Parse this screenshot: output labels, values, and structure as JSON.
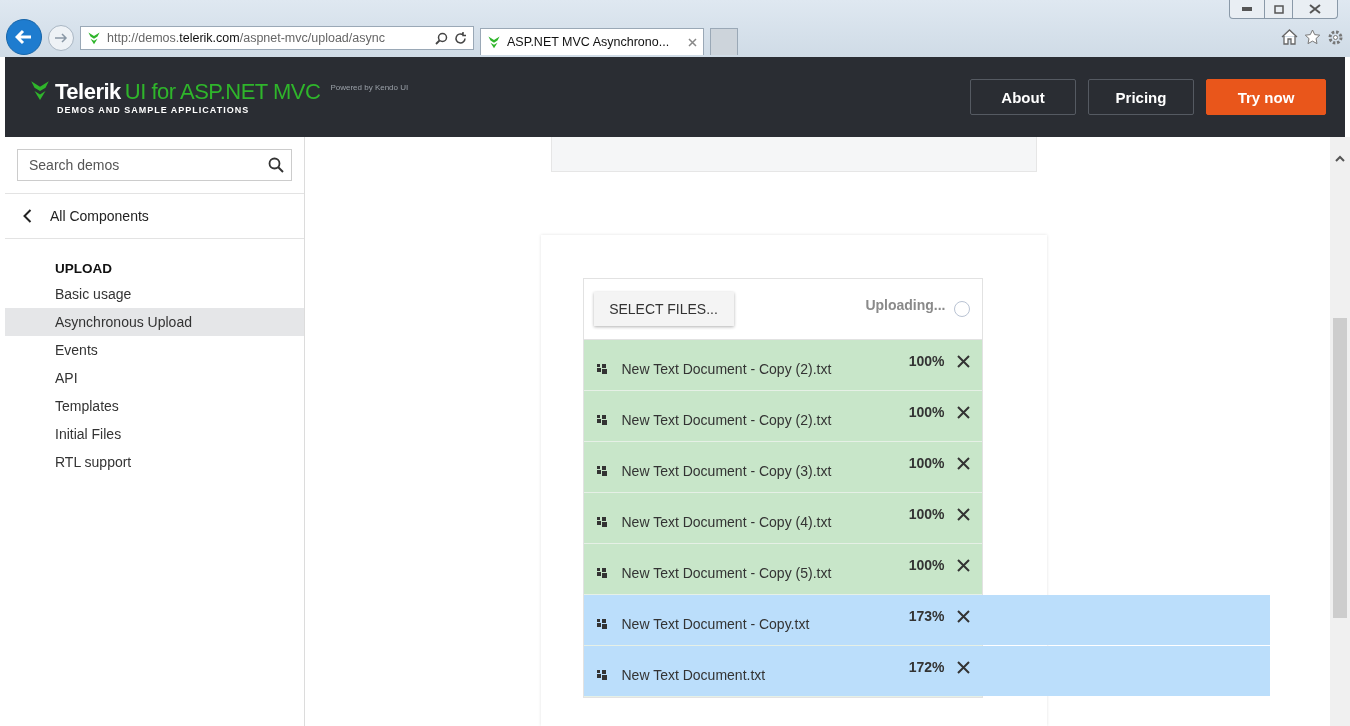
{
  "browser": {
    "address": {
      "prefix": "http://demos.",
      "domain": "telerik.com",
      "path": "/aspnet-mvc/upload/async"
    },
    "tabs": [
      {
        "title": "ASP.NET MVC Asynchrono...",
        "selected": true
      }
    ]
  },
  "header": {
    "brand": "Telerik",
    "product": "UI for ASP.NET MVC",
    "powered": "Powered by Kendo UI",
    "tagline": "DEMOS AND SAMPLE APPLICATIONS",
    "nav": [
      {
        "label": "About",
        "kind": "outline"
      },
      {
        "label": "Pricing",
        "kind": "outline"
      },
      {
        "label": "Try now",
        "kind": "primary"
      }
    ]
  },
  "sidebar": {
    "search": {
      "placeholder": "Search demos"
    },
    "back": "All Components",
    "section": "UPLOAD",
    "items": [
      {
        "label": "Basic usage",
        "selected": false
      },
      {
        "label": "Asynchronous Upload",
        "selected": true
      },
      {
        "label": "Events",
        "selected": false
      },
      {
        "label": "API",
        "selected": false
      },
      {
        "label": "Templates",
        "selected": false
      },
      {
        "label": "Initial Files",
        "selected": false
      },
      {
        "label": "RTL support",
        "selected": false
      }
    ]
  },
  "upload": {
    "button": "SELECT FILES...",
    "status": "Uploading...",
    "files": [
      {
        "name": "New Text Document - Copy (2).txt",
        "percent": "100%",
        "kind": "done"
      },
      {
        "name": "New Text Document - Copy (2).txt",
        "percent": "100%",
        "kind": "done"
      },
      {
        "name": "New Text Document - Copy (3).txt",
        "percent": "100%",
        "kind": "done"
      },
      {
        "name": "New Text Document - Copy (4).txt",
        "percent": "100%",
        "kind": "done"
      },
      {
        "name": "New Text Document - Copy (5).txt",
        "percent": "100%",
        "kind": "done"
      },
      {
        "name": "New Text Document - Copy.txt",
        "percent": "173%",
        "kind": "overflow"
      },
      {
        "name": "New Text Document.txt",
        "percent": "172%",
        "kind": "overflow"
      }
    ]
  }
}
